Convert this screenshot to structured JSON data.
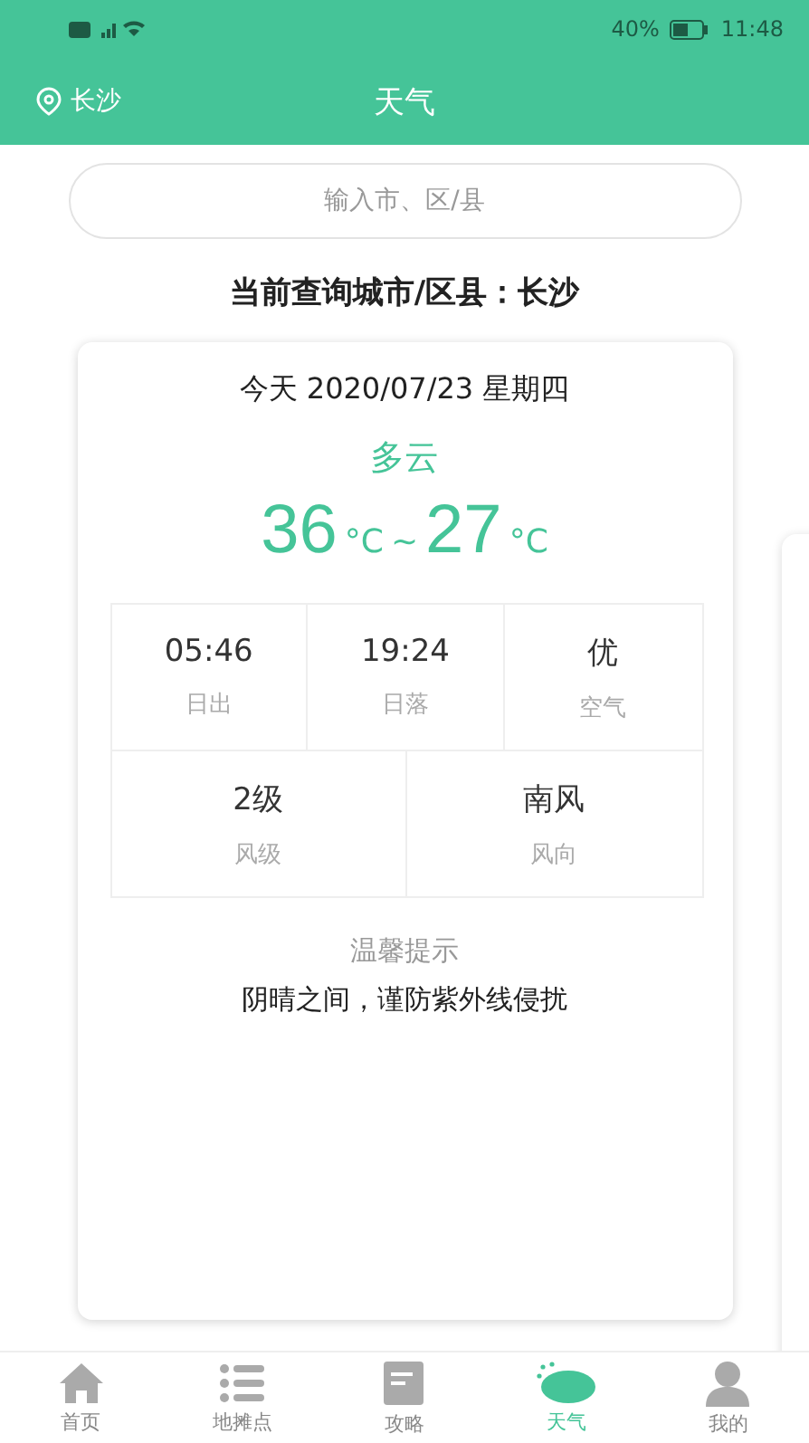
{
  "status_bar": {
    "battery": "40%",
    "time": "11:48"
  },
  "header": {
    "location": "长沙",
    "title": "天气"
  },
  "search": {
    "placeholder": "输入市、区/县"
  },
  "current_city": "当前查询城市/区县：长沙",
  "weather": {
    "date": "今天 2020/07/23 星期四",
    "condition": "多云",
    "high": "36",
    "low": "27",
    "high_unit": "°C",
    "low_unit": "°C",
    "separator": "~",
    "stats_top": [
      {
        "value": "05:46",
        "label": "日出"
      },
      {
        "value": "19:24",
        "label": "日落"
      },
      {
        "value": "优",
        "label": "空气"
      }
    ],
    "stats_bottom": [
      {
        "value": "2级",
        "label": "风级"
      },
      {
        "value": "南风",
        "label": "风向"
      }
    ],
    "tip_title": "温馨提示",
    "tip": "阴晴之间，谨防紫外线侵扰"
  },
  "nav": [
    {
      "kind": "home",
      "label": "首页",
      "selected": false
    },
    {
      "kind": "list",
      "label": "地摊点",
      "selected": false
    },
    {
      "kind": "book",
      "label": "攻略",
      "selected": false
    },
    {
      "kind": "weather",
      "label": "天气",
      "selected": true
    },
    {
      "kind": "person",
      "label": "我的",
      "selected": false
    }
  ]
}
